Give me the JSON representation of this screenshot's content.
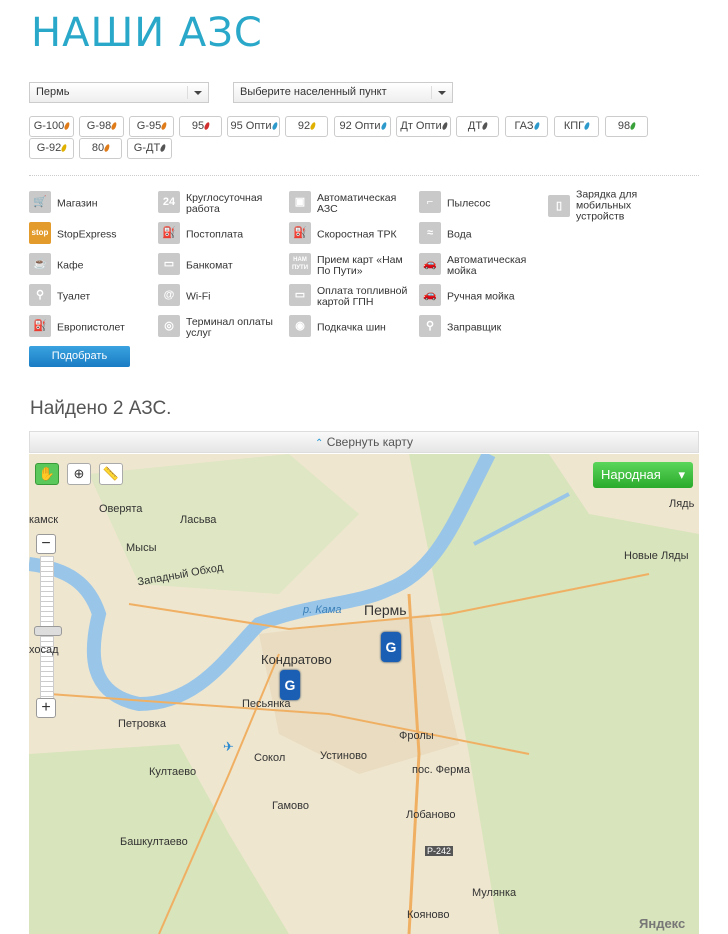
{
  "page": {
    "title": "НАШИ АЗС"
  },
  "filters": {
    "city_select": "Пермь",
    "locality_select": "Выберите населенный пункт"
  },
  "fuels": [
    {
      "label": "G-100",
      "color": "#e07b1a"
    },
    {
      "label": "G-98",
      "color": "#e07b1a"
    },
    {
      "label": "G-95",
      "color": "#e07b1a"
    },
    {
      "label": "95",
      "color": "#d03030"
    },
    {
      "label": "95 Опти",
      "color": "#2d9acb"
    },
    {
      "label": "92",
      "color": "#e0b000"
    },
    {
      "label": "92 Опти",
      "color": "#2d9acb"
    },
    {
      "label": "Дт Опти",
      "color": "#555555"
    },
    {
      "label": "ДТ",
      "color": "#555555"
    },
    {
      "label": "ГАЗ",
      "color": "#2d9acb"
    },
    {
      "label": "КПГ",
      "color": "#2d9acb"
    },
    {
      "label": "98",
      "color": "#3aa13a"
    },
    {
      "label": "G-92",
      "color": "#e0b000"
    },
    {
      "label": "80",
      "color": "#e07b1a"
    },
    {
      "label": "G-ДТ",
      "color": "#555555"
    }
  ],
  "services": [
    {
      "label": "Магазин",
      "icon": "cart-icon"
    },
    {
      "label": "StopExpress",
      "icon": "stopexpress-icon"
    },
    {
      "label": "Кафе",
      "icon": "cafe-icon"
    },
    {
      "label": "Туалет",
      "icon": "toilet-icon"
    },
    {
      "label": "Европистолет",
      "icon": "pistol-icon"
    },
    {
      "label": "Круглосуточная работа",
      "icon": "24h-icon"
    },
    {
      "label": "Постоплата",
      "icon": "postpay-icon"
    },
    {
      "label": "Банкомат",
      "icon": "atm-icon"
    },
    {
      "label": "Wi-Fi",
      "icon": "wifi-icon"
    },
    {
      "label": "Терминал оплаты услуг",
      "icon": "terminal-icon"
    },
    {
      "label": "Автоматическая АЗС",
      "icon": "auto-station-icon"
    },
    {
      "label": "Скоростная ТРК",
      "icon": "fast-pump-icon"
    },
    {
      "label": "Прием карт «Нам По Пути»",
      "icon": "card-icon"
    },
    {
      "label": "Оплата топливной картой ГПН",
      "icon": "fuel-card-icon"
    },
    {
      "label": "Подкачка шин",
      "icon": "tire-icon"
    },
    {
      "label": "Пылесос",
      "icon": "vacuum-icon"
    },
    {
      "label": "Вода",
      "icon": "water-icon"
    },
    {
      "label": "Автоматическая мойка",
      "icon": "auto-wash-icon"
    },
    {
      "label": "Ручная мойка",
      "icon": "hand-wash-icon"
    },
    {
      "label": "Заправщик",
      "icon": "attendant-icon"
    },
    {
      "label": "Зарядка для мобильных устройств",
      "icon": "charger-icon"
    }
  ],
  "submit_label": "Подобрать",
  "results": {
    "found_text": "Найдено 2 АЗС."
  },
  "map": {
    "collapse_label": "Свернуть карту",
    "layer_label": "Народная",
    "copyright": "Яндекс",
    "places": [
      "камск",
      "Оверята",
      "Ласьва",
      "Мысы",
      "Западный Обход",
      "р. Кама",
      "Пермь",
      "Кондратово",
      "Песьянка",
      "хосад",
      "Петровка",
      "Култаево",
      "Сокол",
      "Устиново",
      "Фролы",
      "пос. Ферма",
      "Гамово",
      "Лобаново",
      "Башкултаево",
      "Р-242",
      "Мулянка",
      "Кояново",
      "Лядь",
      "Новые Ляды"
    ]
  }
}
